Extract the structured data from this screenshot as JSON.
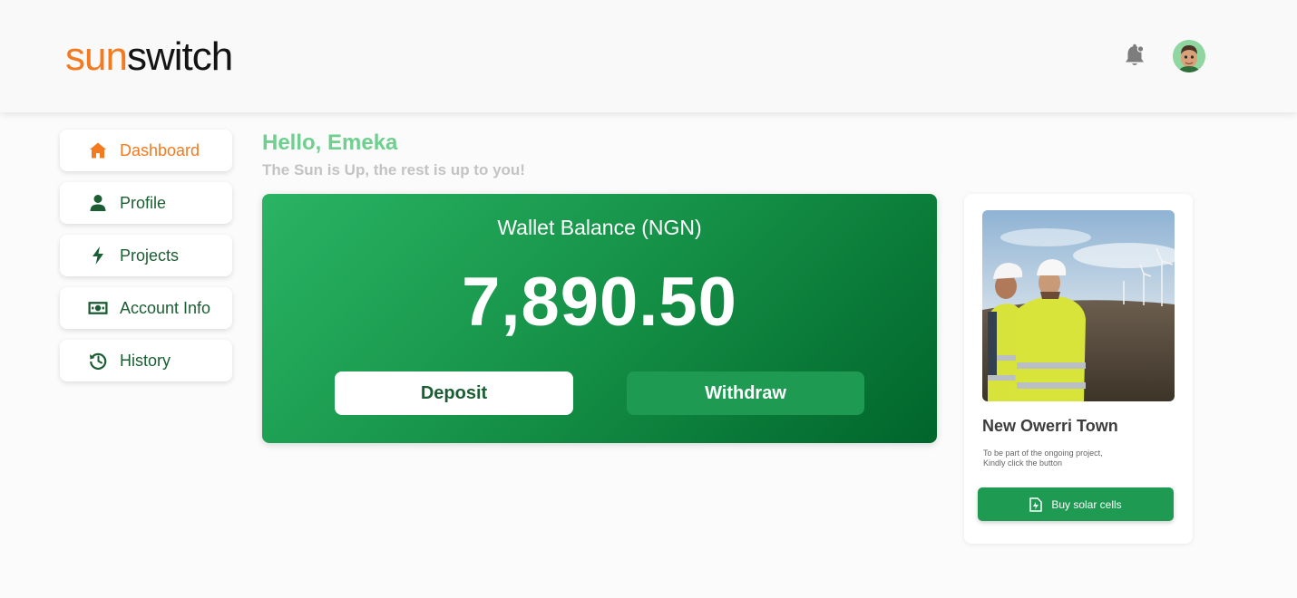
{
  "header": {
    "logo_part1": "sun",
    "logo_part2": "switch",
    "icons": [
      "bell-icon",
      "avatar"
    ]
  },
  "sidebar": {
    "items": [
      {
        "label": "Dashboard",
        "icon": "home-icon",
        "active": true
      },
      {
        "label": "Profile",
        "icon": "user-icon",
        "active": false
      },
      {
        "label": "Projects",
        "icon": "lightning-icon",
        "active": false
      },
      {
        "label": "Account Info",
        "icon": "money-icon",
        "active": false
      },
      {
        "label": "History",
        "icon": "history-icon",
        "active": false
      }
    ]
  },
  "main": {
    "greeting": "Hello, Emeka",
    "tagline": "The Sun is Up, the rest is up to you!",
    "wallet": {
      "title": "Wallet Balance (NGN)",
      "amount": "7,890.50",
      "deposit_label": "Deposit",
      "withdraw_label": "Withdraw"
    }
  },
  "project_card": {
    "title": "New Owerri Town",
    "description_line1": "To be part of the ongoing project,",
    "description_line2": "Kindly click the button",
    "button_label": "Buy solar cells",
    "button_icon": "solar-cell-icon"
  },
  "colors": {
    "brand_orange": "#f47a20",
    "brand_green": "#1f9a53",
    "dark_green": "#1b5e33",
    "greeting_green": "#6fcf8f"
  }
}
